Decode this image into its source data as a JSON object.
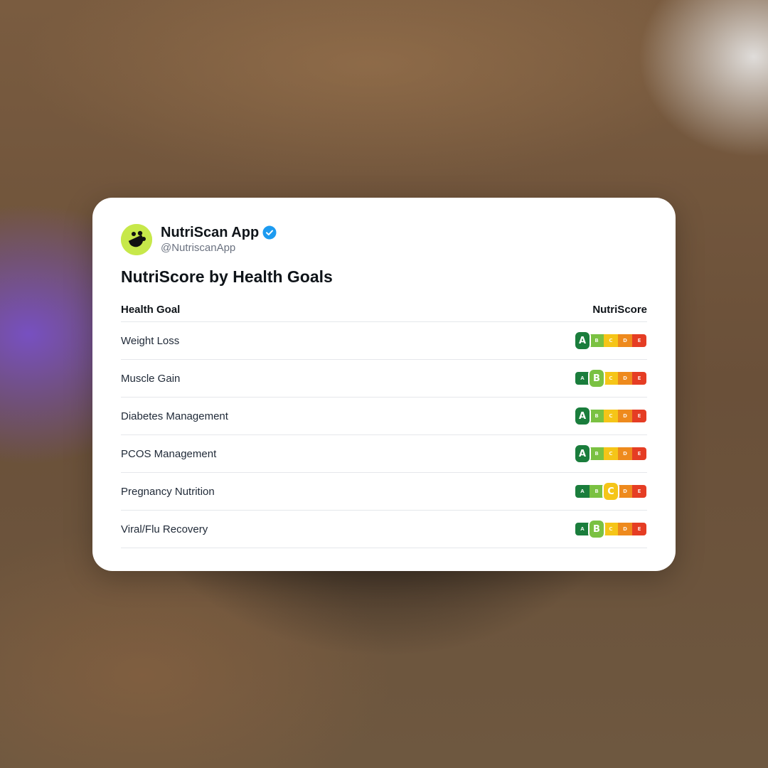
{
  "account": {
    "name": "NutriScan App",
    "handle": "@NutriscanApp",
    "verified_icon": "verified-badge-icon",
    "avatar_icon": "nutriscan-logo-icon"
  },
  "post": {
    "title": "NutriScore by Health Goals"
  },
  "table": {
    "headers": {
      "goal": "Health Goal",
      "score": "NutriScore"
    },
    "grades": [
      "A",
      "B",
      "C",
      "D",
      "E"
    ],
    "grade_colors": {
      "A": "#1a7d3c",
      "B": "#7ac142",
      "C": "#f5c518",
      "D": "#ee8a1d",
      "E": "#e53d24"
    },
    "rows": [
      {
        "goal": "Weight Loss",
        "score": "A"
      },
      {
        "goal": "Muscle Gain",
        "score": "B"
      },
      {
        "goal": "Diabetes Management",
        "score": "A"
      },
      {
        "goal": "PCOS Management",
        "score": "A"
      },
      {
        "goal": "Pregnancy Nutrition",
        "score": "C"
      },
      {
        "goal": "Viral/Flu Recovery",
        "score": "B"
      }
    ]
  },
  "colors": {
    "card_bg": "#ffffff",
    "text_primary": "#0f1419",
    "text_muted": "#6b7280",
    "verified_blue": "#1d9bf0",
    "avatar_green": "#c7e84a"
  }
}
